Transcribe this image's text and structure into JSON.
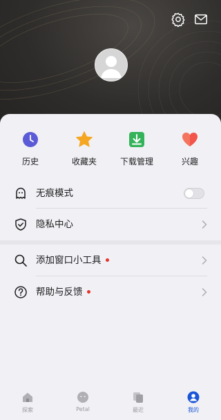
{
  "header": {
    "settings_icon": "gear-icon",
    "mail_icon": "mail-icon",
    "avatar_icon": "default-avatar-icon"
  },
  "quick_actions": [
    {
      "label": "历史",
      "icon": "clock-icon",
      "color": "#5b5bd8"
    },
    {
      "label": "收藏夹",
      "icon": "star-icon",
      "color": "#f5a623"
    },
    {
      "label": "下载管理",
      "icon": "download-icon",
      "color": "#34b35a"
    },
    {
      "label": "兴趣",
      "icon": "heart-icon",
      "color": "#f2554a"
    }
  ],
  "menu": {
    "incognito": {
      "label": "无痕模式",
      "icon": "ghost-icon",
      "toggle_on": false
    },
    "privacy": {
      "label": "隐私中心",
      "icon": "shield-check-icon"
    },
    "widgets": {
      "label": "添加窗口小工具",
      "icon": "search-icon",
      "has_dot": true
    },
    "help": {
      "label": "帮助与反馈",
      "icon": "question-icon",
      "has_dot": true
    }
  },
  "tabbar": {
    "tabs": [
      {
        "label": "探索",
        "icon": "home-icon",
        "active": false
      },
      {
        "label": "Petal",
        "icon": "petal-icon",
        "active": false
      },
      {
        "label": "最近",
        "icon": "recent-icon",
        "active": false
      },
      {
        "label": "我的",
        "icon": "profile-icon",
        "active": true
      }
    ],
    "active_color": "#1a56d6",
    "inactive_color": "#9a9a9e"
  }
}
